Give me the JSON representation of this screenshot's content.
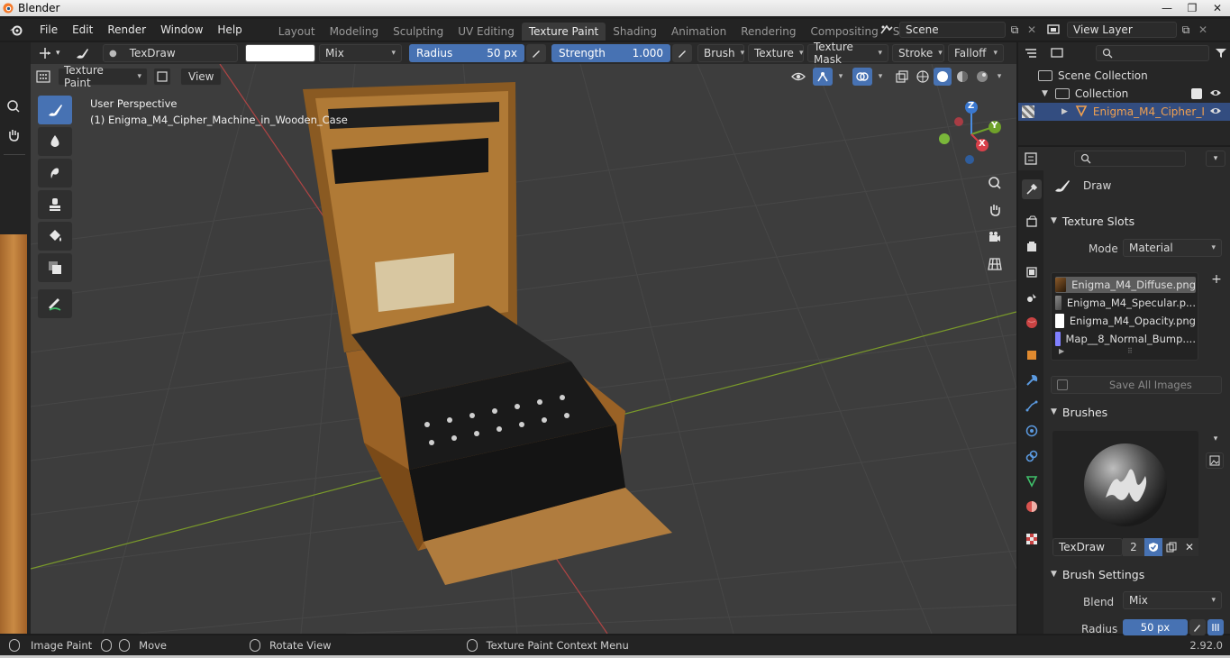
{
  "window": {
    "title": "Blender",
    "minimize": "—",
    "maximize": "❐",
    "close": "✕"
  },
  "menubar": {
    "items": [
      "File",
      "Edit",
      "Render",
      "Window",
      "Help"
    ],
    "workspace_tabs": [
      "Layout",
      "Modeling",
      "Sculpting",
      "UV Editing",
      "Texture Paint",
      "Shading",
      "Animation",
      "Rendering",
      "Compositing",
      "Scripting"
    ],
    "active_tab": "Texture Paint",
    "add_tab": "+",
    "scene": "Scene",
    "view_layer": "View Layer"
  },
  "tool_header": {
    "brush_name": "TexDraw",
    "color": "#ffffff",
    "blend": "Mix",
    "radius_label": "Radius",
    "radius_value": "50 px",
    "strength_label": "Strength",
    "strength_value": "1.000",
    "menus": [
      "Brush",
      "Texture",
      "Texture Mask",
      "Stroke",
      "Falloff"
    ]
  },
  "mode_header": {
    "mode": "Texture Paint",
    "view": "View"
  },
  "viewport": {
    "perspective": "User Perspective",
    "object_label": "(1) Enigma_M4_Cipher_Machine_in_Wooden_Case",
    "gizmo": {
      "x": "X",
      "y": "Y",
      "z": "Z"
    }
  },
  "outliner": {
    "scene_collection": "Scene Collection",
    "collection": "Collection",
    "object": "Enigma_M4_Cipher_I"
  },
  "properties": {
    "tool_name": "Draw",
    "texture_slots": {
      "title": "Texture Slots",
      "mode_label": "Mode",
      "mode_value": "Material",
      "slots": [
        {
          "name": "Enigma_M4_Diffuse.png",
          "color": "#8a5a2a"
        },
        {
          "name": "Enigma_M4_Specular.p...",
          "color": "#6f6f6f"
        },
        {
          "name": "Enigma_M4_Opacity.png",
          "color": "#ffffff"
        },
        {
          "name": "Map__8_Normal_Bump....",
          "color": "#8080ff"
        }
      ],
      "save_all": "Save All Images"
    },
    "brushes": {
      "title": "Brushes",
      "brush_name": "TexDraw",
      "users": "2"
    },
    "brush_settings": {
      "title": "Brush Settings",
      "blend_label": "Blend",
      "blend_value": "Mix",
      "radius_label": "Radius",
      "radius_value": "50 px"
    }
  },
  "statusbar": {
    "items": [
      "Image Paint",
      "Move",
      "Rotate View",
      "Texture Paint Context Menu"
    ],
    "version": "2.92.0"
  }
}
